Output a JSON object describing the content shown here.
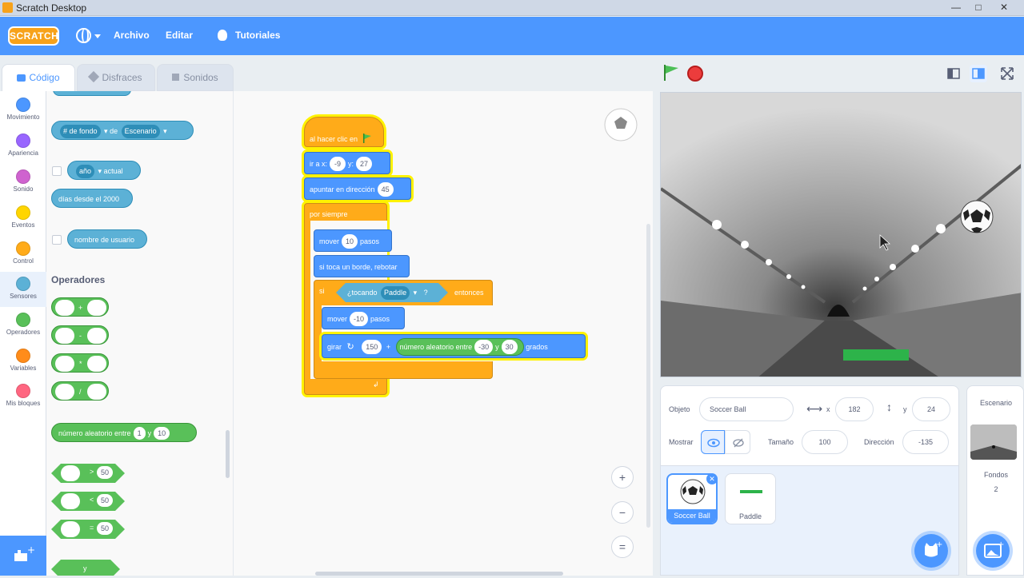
{
  "window": {
    "title": "Scratch Desktop",
    "min": "—",
    "max": "□",
    "close": "✕"
  },
  "menu": {
    "logo": "SCRATCH",
    "archivo": "Archivo",
    "editar": "Editar",
    "tutoriales": "Tutoriales"
  },
  "tabs": {
    "codigo": "Código",
    "disfraces": "Disfraces",
    "sonidos": "Sonidos"
  },
  "categories": [
    {
      "label": "Movimiento",
      "color": "#4c97ff"
    },
    {
      "label": "Apariencia",
      "color": "#9966ff"
    },
    {
      "label": "Sonido",
      "color": "#cf63cf"
    },
    {
      "label": "Eventos",
      "color": "#ffd500"
    },
    {
      "label": "Control",
      "color": "#ffab19"
    },
    {
      "label": "Sensores",
      "color": "#5cb1d6"
    },
    {
      "label": "Operadores",
      "color": "#59c059"
    },
    {
      "label": "Variables",
      "color": "#ff8c1a"
    },
    {
      "label": "Mis bloques",
      "color": "#ff6680"
    }
  ],
  "palette": {
    "fondo_attr": "# de fondo",
    "de": "de",
    "escenario": "Escenario",
    "anio": "año",
    "actual": "actual",
    "dias": "días desde el 2000",
    "usuario": "nombre de usuario",
    "operadores_title": "Operadores",
    "op_plus": "+",
    "op_minus": "-",
    "op_times": "*",
    "op_div": "/",
    "random_label": "número aleatorio entre",
    "random_from": "1",
    "random_y": "y",
    "random_to": "10",
    "gt": ">",
    "lt": "<",
    "eq": "=",
    "cmp_val": "50",
    "and_label": "y"
  },
  "script": {
    "hat": "al hacer clic en",
    "goto": "ir a x:",
    "goto_x": "-9",
    "goto_y_lbl": "y:",
    "goto_y": "27",
    "point": "apuntar en dirección",
    "point_val": "45",
    "forever": "por siempre",
    "move": "mover",
    "move_val": "10",
    "pasos": "pasos",
    "bounce": "si toca un borde, rebotar",
    "si": "si",
    "touching": "¿tocando",
    "paddle": "Paddle",
    "q": "?",
    "then": "entonces",
    "move2_val": "-10",
    "turn": "girar",
    "turn_val": "150",
    "plus": "+",
    "random": "número aleatorio entre",
    "rand_from": "-30",
    "y": "y",
    "rand_to": "30",
    "grados": "grados"
  },
  "zoom": {
    "in": "+",
    "out": "−",
    "reset": "="
  },
  "sprite": {
    "objeto_lbl": "Objeto",
    "name": "Soccer Ball",
    "x_lbl": "x",
    "x": "182",
    "y_lbl": "y",
    "y": "24",
    "mostrar": "Mostrar",
    "tamano_lbl": "Tamaño",
    "tamano": "100",
    "direccion_lbl": "Dirección",
    "direccion": "-135"
  },
  "sprites": [
    {
      "name": "Soccer Ball"
    },
    {
      "name": "Paddle"
    }
  ],
  "backdrop": {
    "title": "Escenario",
    "fondos_lbl": "Fondos",
    "fondos": "2"
  }
}
